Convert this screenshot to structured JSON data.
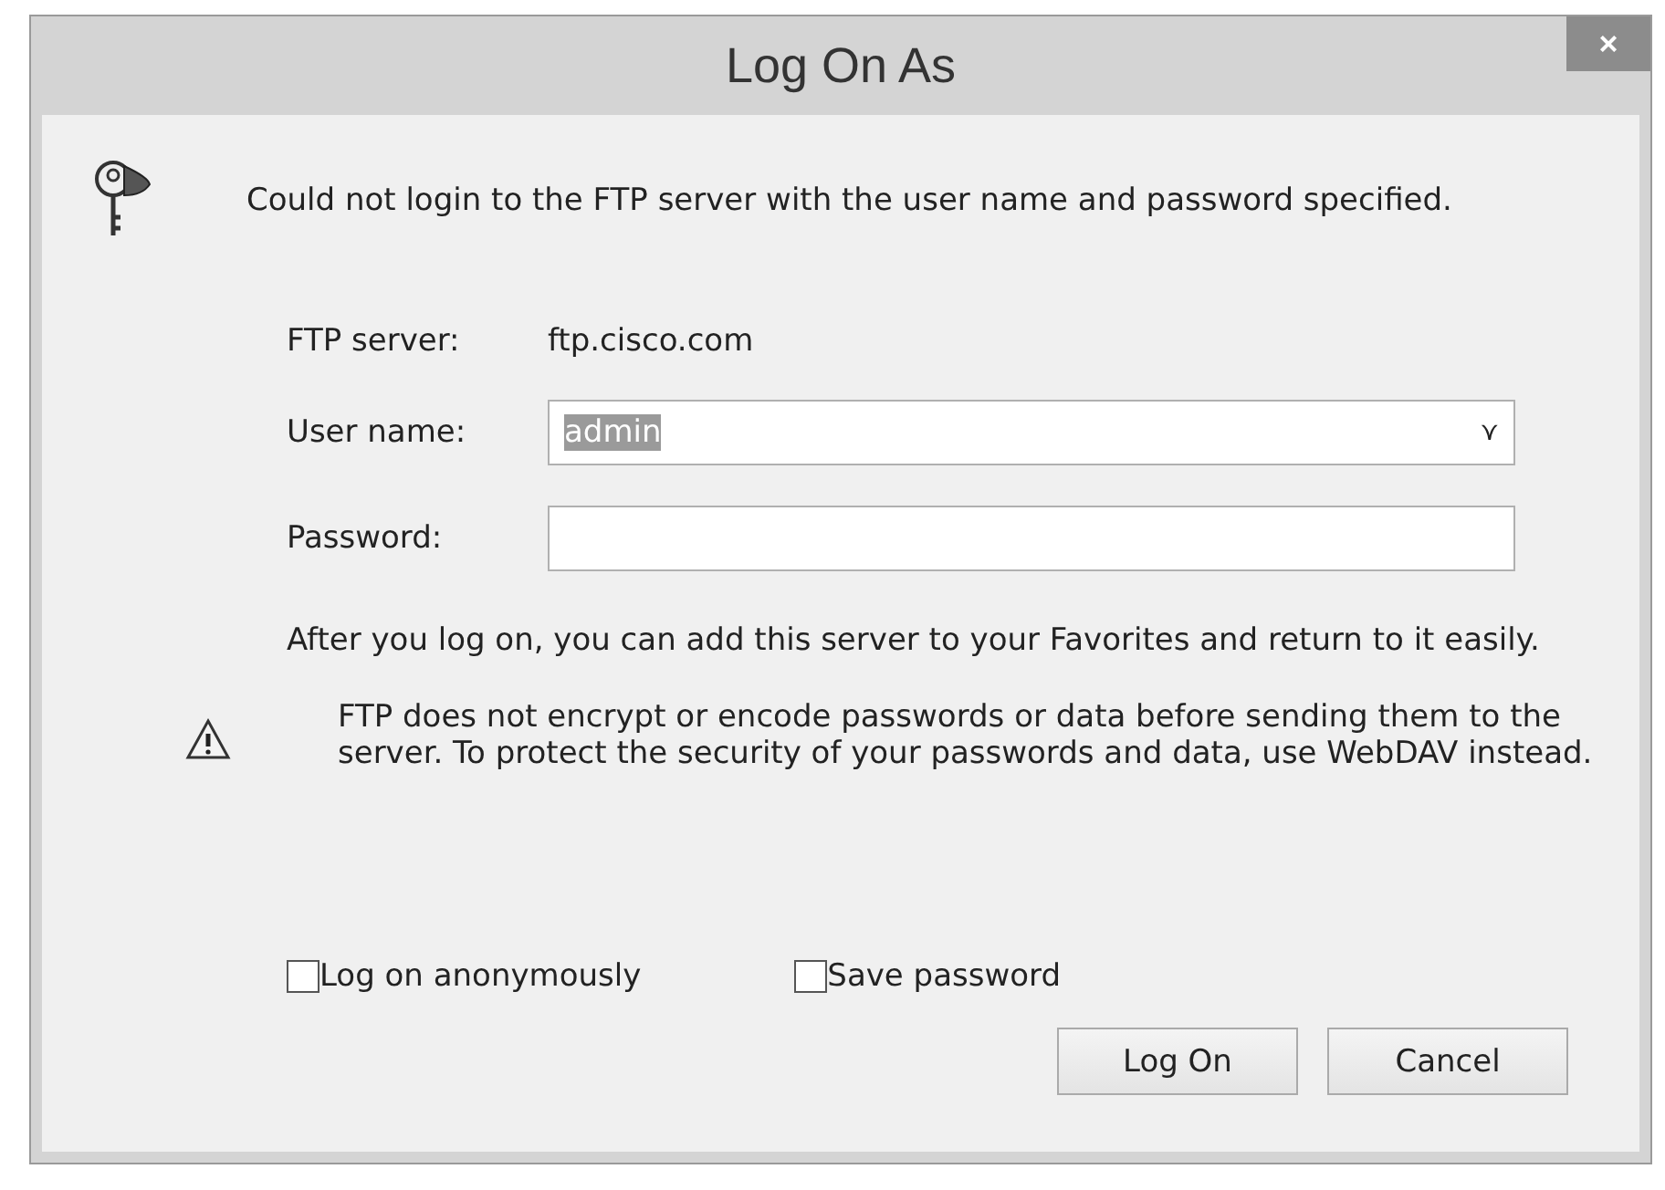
{
  "window": {
    "title": "Log On As",
    "close": "×"
  },
  "message": "Could not login to the FTP server with the user name and password specified.",
  "server": {
    "label": "FTP server:",
    "value": "ftp.cisco.com"
  },
  "fields": [
    {
      "label": "User name:",
      "kind": "combo",
      "value": "admin",
      "highlighted": true,
      "caret": "⋎"
    },
    {
      "label": "Password:",
      "kind": "text"
    }
  ],
  "info": "After you log on, you can add this server to your Favorites and return to it easily.",
  "warning": "FTP does not encrypt or encode passwords or data before sending them to the server.  To protect the security of your passwords and data, use WebDAV instead.",
  "checkboxes": [
    {
      "label": "Log on anonymously",
      "checked": false
    },
    {
      "label": "Save password",
      "checked": false
    }
  ],
  "buttons": [
    "Log On",
    "Cancel"
  ]
}
